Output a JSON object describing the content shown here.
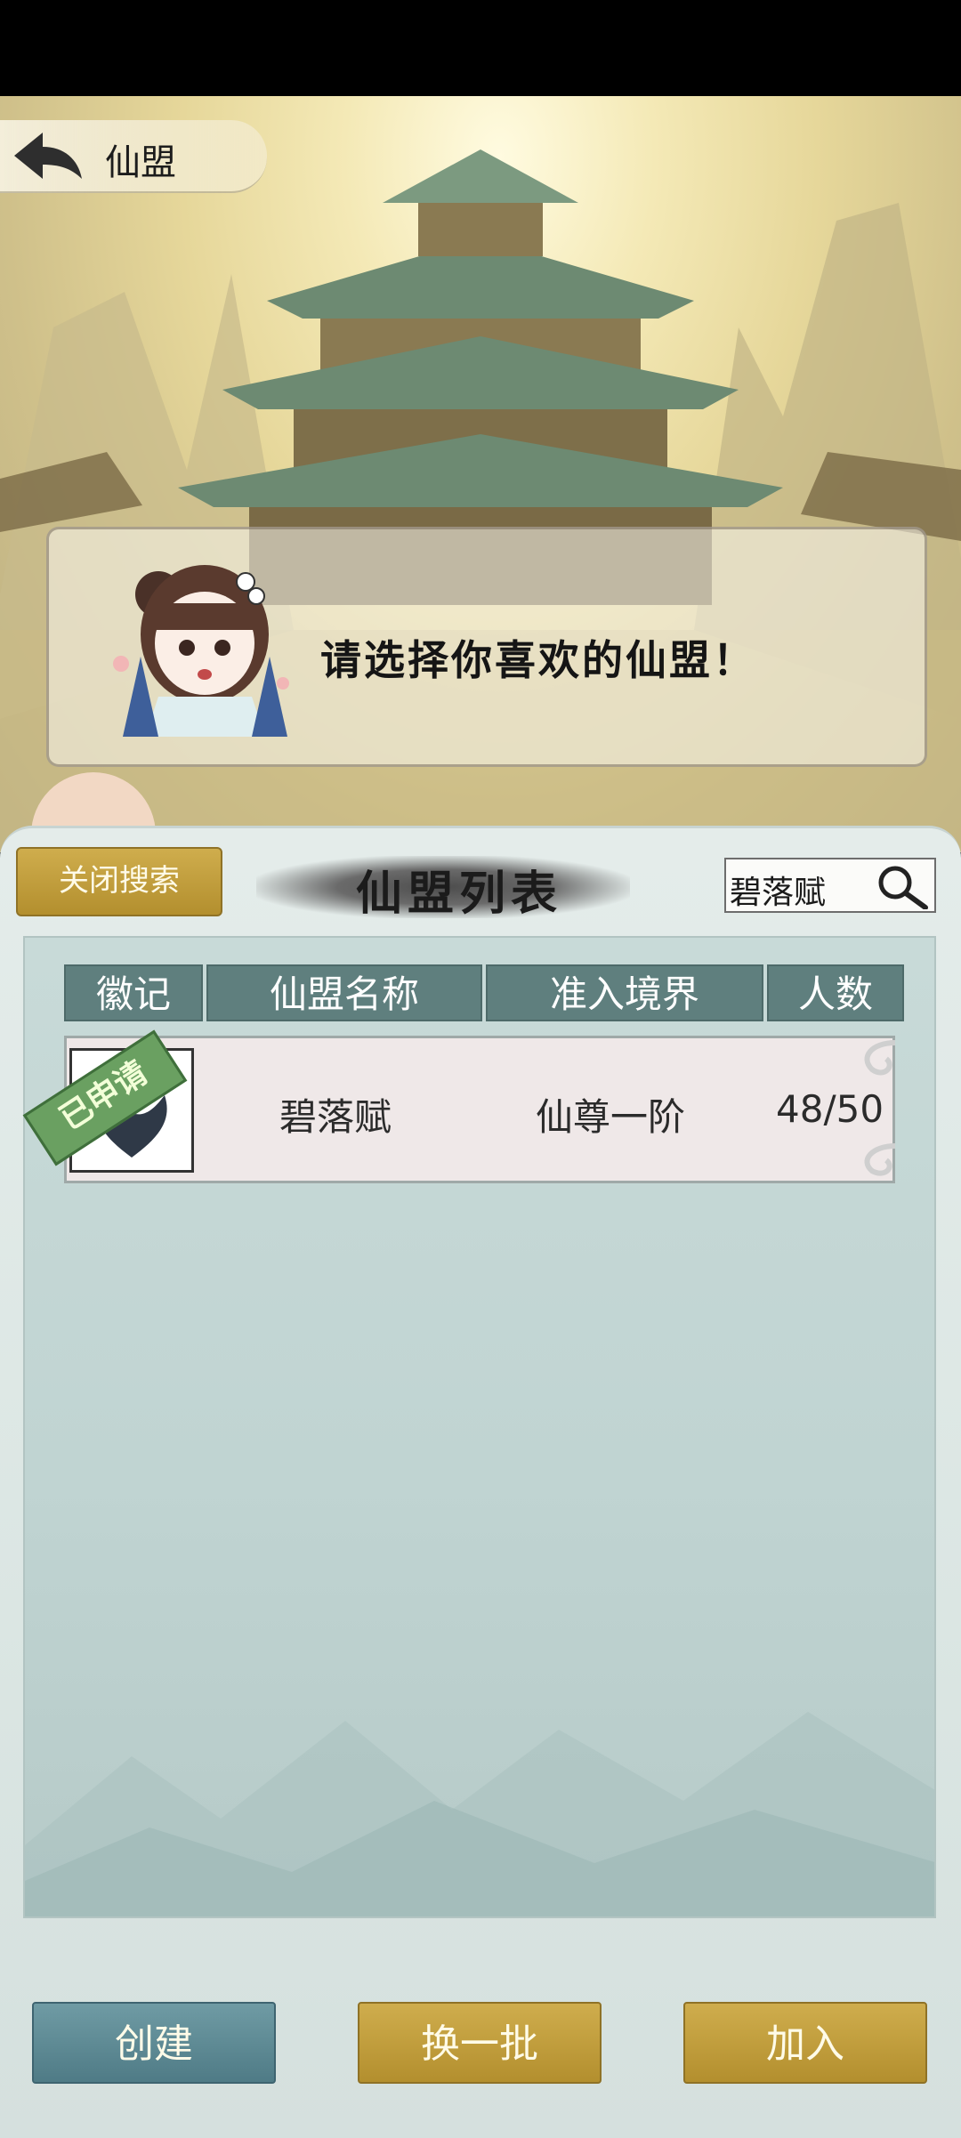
{
  "header": {
    "title": "仙盟"
  },
  "dialog": {
    "message": "请选择你喜欢的仙盟！"
  },
  "search": {
    "close_label": "关闭搜索",
    "query": "碧落赋"
  },
  "list": {
    "title": "仙盟列表",
    "columns": [
      "徽记",
      "仙盟名称",
      "准入境界",
      "人数"
    ],
    "rows": [
      {
        "badge": "已申请",
        "name": "碧落赋",
        "realm": "仙尊一阶",
        "members": "48/50"
      }
    ]
  },
  "actions": {
    "create": "创建",
    "refresh": "换一批",
    "join": "加入"
  },
  "colors": {
    "gold_button": "#b8952f",
    "teal_button": "#5a8792",
    "header_cell": "#5f7f7e"
  }
}
